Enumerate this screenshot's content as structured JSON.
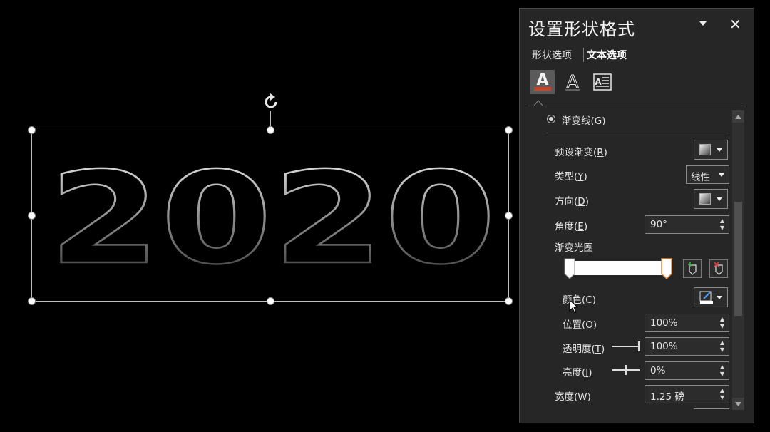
{
  "canvas": {
    "text": "2020"
  },
  "pane": {
    "title": "设置形状格式",
    "tabs": [
      {
        "label": "形状选项",
        "active": false
      },
      {
        "label": "文本选项",
        "active": true
      }
    ],
    "icons": [
      "text-fill-outline-icon",
      "text-effects-icon",
      "textbox-icon"
    ],
    "section": {
      "label": "渐变线",
      "key": "G"
    },
    "rows": {
      "preset": {
        "label": "预设渐变",
        "key": "R"
      },
      "type": {
        "label": "类型",
        "key": "Y",
        "value": "线性"
      },
      "direction": {
        "label": "方向",
        "key": "D"
      },
      "angle": {
        "label": "角度",
        "key": "E",
        "value": "90°"
      },
      "stops_label": "渐变光圈",
      "color": {
        "label": "颜色",
        "key": "C"
      },
      "position": {
        "label": "位置",
        "key": "O",
        "value": "100%"
      },
      "transparency": {
        "label": "透明度",
        "key": "T",
        "value": "100%"
      },
      "brightness": {
        "label": "亮度",
        "key": "I",
        "value": "0%"
      },
      "width": {
        "label": "宽度",
        "key": "W",
        "value": "1.25 磅"
      }
    }
  },
  "colors": {
    "accent": "#c7442a",
    "pane_bg": "#262626",
    "canvas_bg": "#000000"
  }
}
